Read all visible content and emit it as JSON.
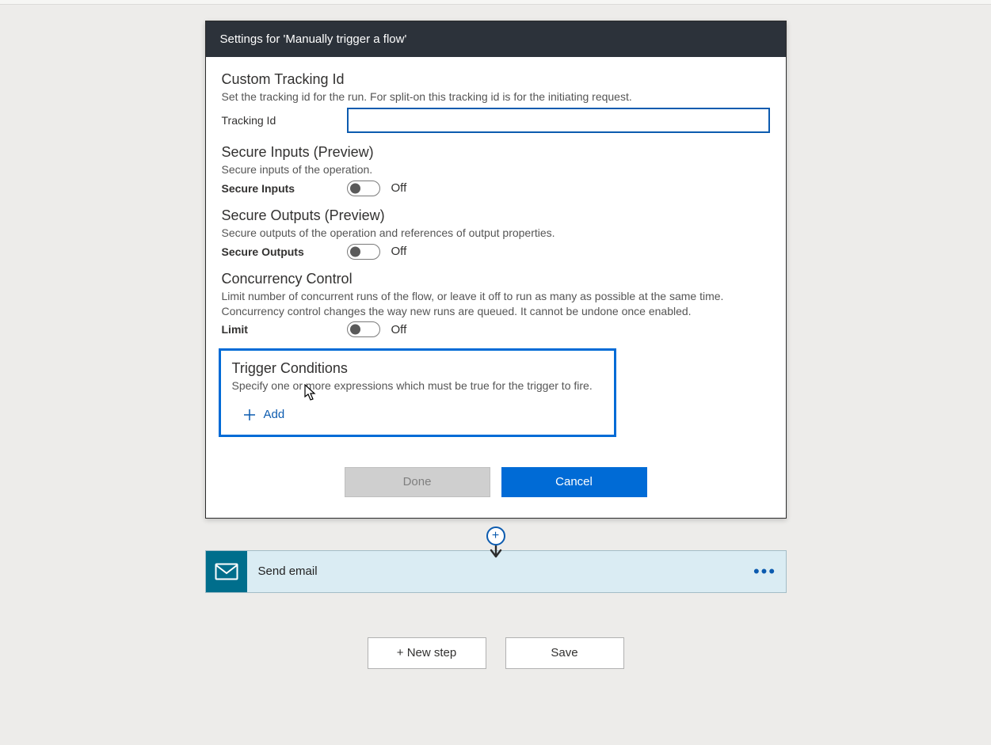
{
  "dialog": {
    "title": "Settings for 'Manually trigger a flow'",
    "customTracking": {
      "title": "Custom Tracking Id",
      "desc": "Set the tracking id for the run. For split-on this tracking id is for the initiating request.",
      "fieldLabel": "Tracking Id",
      "value": ""
    },
    "secureInputs": {
      "title": "Secure Inputs (Preview)",
      "desc": "Secure inputs of the operation.",
      "fieldLabel": "Secure Inputs",
      "state": "Off"
    },
    "secureOutputs": {
      "title": "Secure Outputs (Preview)",
      "desc": "Secure outputs of the operation and references of output properties.",
      "fieldLabel": "Secure Outputs",
      "state": "Off"
    },
    "concurrency": {
      "title": "Concurrency Control",
      "desc": "Limit number of concurrent runs of the flow, or leave it off to run as many as possible at the same time. Concurrency control changes the way new runs are queued. It cannot be undone once enabled.",
      "fieldLabel": "Limit",
      "state": "Off"
    },
    "triggerConditions": {
      "title": "Trigger Conditions",
      "desc": "Specify one or more expressions which must be true for the trigger to fire.",
      "addLabel": "Add"
    },
    "buttons": {
      "done": "Done",
      "cancel": "Cancel"
    }
  },
  "connector": {
    "addAria": "+"
  },
  "step": {
    "label": "Send email"
  },
  "bottom": {
    "newStep": "+ New step",
    "save": "Save"
  }
}
